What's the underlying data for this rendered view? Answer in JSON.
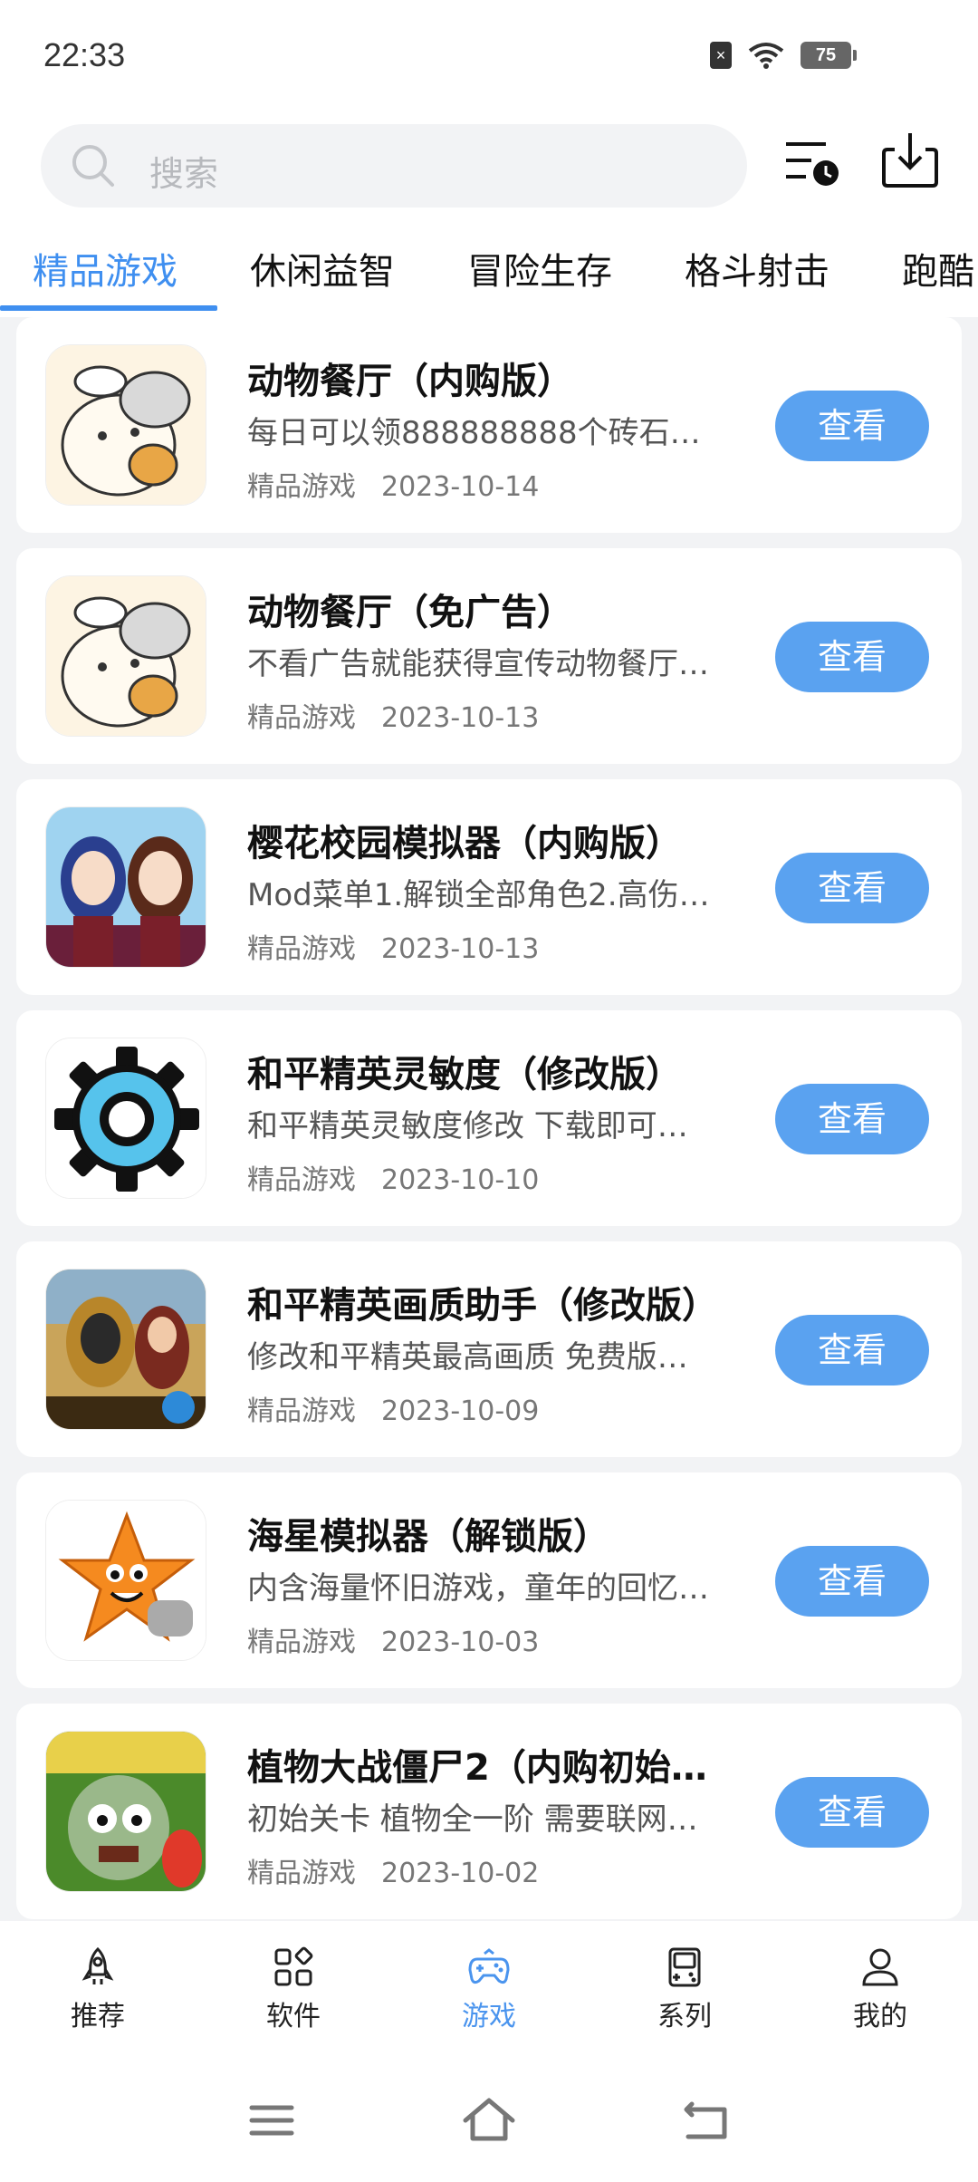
{
  "status": {
    "time": "22:33",
    "battery": "75",
    "sim": "×"
  },
  "search": {
    "placeholder": "搜索"
  },
  "tabs": [
    "精品游戏",
    "休闲益智",
    "冒险生存",
    "格斗射击",
    "跑酷"
  ],
  "apps": [
    {
      "title": "动物餐厅（内购版）",
      "desc": "每日可以领888888888个砖石…",
      "category": "精品游戏",
      "date": "2023-10-14",
      "button": "查看",
      "icon": "cat-icon"
    },
    {
      "title": "动物餐厅（免广告）",
      "desc": "不看广告就能获得宣传动物餐厅…",
      "category": "精品游戏",
      "date": "2023-10-13",
      "button": "查看",
      "icon": "cat-icon"
    },
    {
      "title": "樱花校园模拟器（内购版）",
      "desc": "Mod菜单1.解锁全部角色2.高伤…",
      "category": "精品游戏",
      "date": "2023-10-13",
      "button": "查看",
      "icon": "anime-girls-icon"
    },
    {
      "title": "和平精英灵敏度（修改版）",
      "desc": "和平精英灵敏度修改 下载即可…",
      "category": "精品游戏",
      "date": "2023-10-10",
      "button": "查看",
      "icon": "gear-icon"
    },
    {
      "title": "和平精英画质助手（修改版）",
      "desc": "修改和平精英最高画质 免费版…",
      "category": "精品游戏",
      "date": "2023-10-09",
      "button": "查看",
      "icon": "soldiers-icon"
    },
    {
      "title": "海星模拟器（解锁版）",
      "desc": "内含海量怀旧游戏，童年的回忆…",
      "category": "精品游戏",
      "date": "2023-10-03",
      "button": "查看",
      "icon": "starfish-icon"
    },
    {
      "title": "植物大战僵尸2（内购初始…",
      "desc": "初始关卡 植物全一阶 需要联网…",
      "category": "精品游戏",
      "date": "2023-10-02",
      "button": "查看",
      "icon": "zombie-icon"
    }
  ],
  "nav": [
    {
      "label": "推荐",
      "icon": "rocket-icon"
    },
    {
      "label": "软件",
      "icon": "apps-grid-icon"
    },
    {
      "label": "游戏",
      "icon": "gamepad-icon"
    },
    {
      "label": "系列",
      "icon": "handheld-console-icon"
    },
    {
      "label": "我的",
      "icon": "person-icon"
    }
  ],
  "colors": {
    "accent": "#3f8ff0",
    "button": "#5aa2f0"
  }
}
